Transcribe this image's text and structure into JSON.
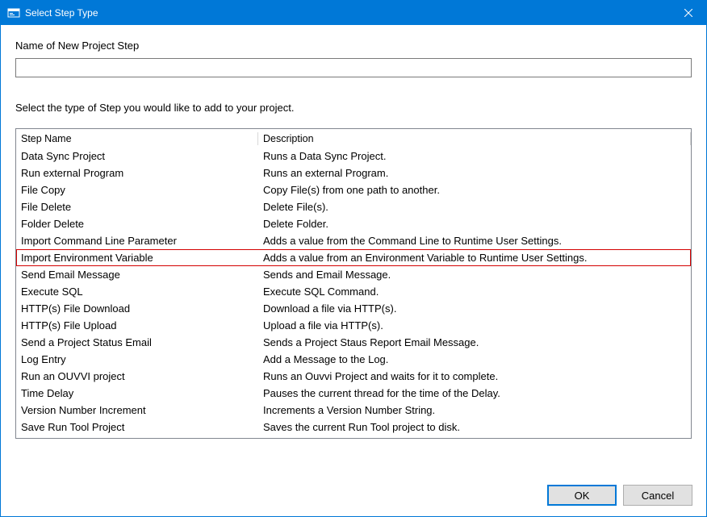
{
  "window": {
    "title": "Select Step Type"
  },
  "labels": {
    "name_prompt": "Name of New Project Step",
    "instruction": "Select the type of Step you would like to add to your project."
  },
  "input": {
    "name_value": ""
  },
  "columns": {
    "name": "Step Name",
    "description": "Description"
  },
  "steps": [
    {
      "name": "Data Sync Project",
      "description": "Runs a Data Sync Project.",
      "highlighted": false
    },
    {
      "name": "Run external Program",
      "description": "Runs an external Program.",
      "highlighted": false
    },
    {
      "name": "File Copy",
      "description": "Copy File(s) from one path to another.",
      "highlighted": false
    },
    {
      "name": "File Delete",
      "description": "Delete File(s).",
      "highlighted": false
    },
    {
      "name": "Folder Delete",
      "description": "Delete Folder.",
      "highlighted": false
    },
    {
      "name": "Import Command Line Parameter",
      "description": "Adds a value from the Command Line to Runtime User Settings.",
      "highlighted": false
    },
    {
      "name": "Import Environment Variable",
      "description": "Adds a value from an Environment Variable to Runtime User Settings.",
      "highlighted": true
    },
    {
      "name": "Send Email Message",
      "description": "Sends and Email Message.",
      "highlighted": false
    },
    {
      "name": "Execute SQL",
      "description": "Execute SQL Command.",
      "highlighted": false
    },
    {
      "name": "HTTP(s) File Download",
      "description": "Download a file via HTTP(s).",
      "highlighted": false
    },
    {
      "name": "HTTP(s) File Upload",
      "description": "Upload a file via HTTP(s).",
      "highlighted": false
    },
    {
      "name": "Send a Project Status Email",
      "description": "Sends a Project Staus Report Email Message.",
      "highlighted": false
    },
    {
      "name": "Log Entry",
      "description": "Add a Message to the Log.",
      "highlighted": false
    },
    {
      "name": "Run an OUVVI project",
      "description": "Runs an Ouvvi Project and waits for it to complete.",
      "highlighted": false
    },
    {
      "name": "Time Delay",
      "description": "Pauses the current thread for the time of the Delay.",
      "highlighted": false
    },
    {
      "name": "Version Number Increment",
      "description": "Increments a Version Number String.",
      "highlighted": false
    },
    {
      "name": "Save Run Tool Project",
      "description": "Saves the current Run Tool project to disk.",
      "highlighted": false
    }
  ],
  "buttons": {
    "ok": "OK",
    "cancel": "Cancel"
  }
}
